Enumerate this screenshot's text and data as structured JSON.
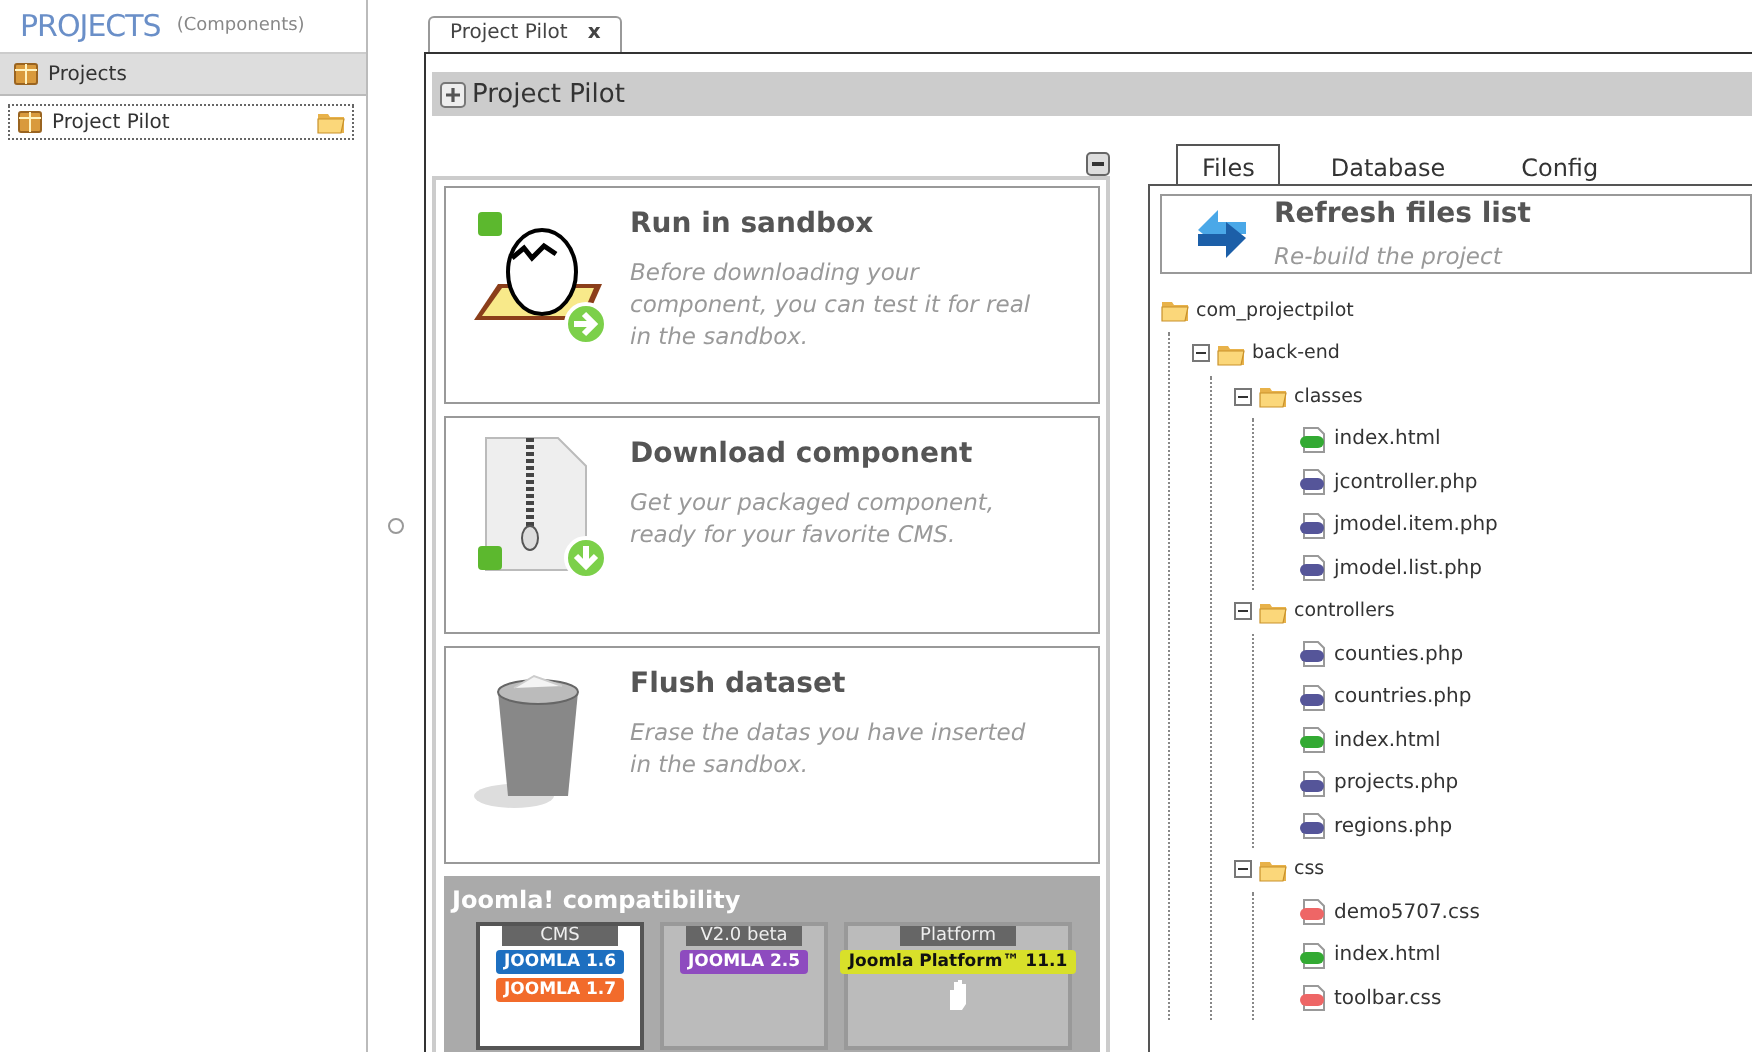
{
  "header": {
    "title": "PROJECTS",
    "subtitle": "(Components)"
  },
  "sidebar": {
    "heading": "Projects",
    "items": [
      {
        "label": "Project Pilot",
        "selected": true
      }
    ]
  },
  "document_tabs": [
    {
      "label": "Project Pilot",
      "close": "x",
      "selected": true
    }
  ],
  "panel": {
    "title": "Project Pilot"
  },
  "actions": [
    {
      "kind": "sandbox",
      "title": "Run in sandbox",
      "description": "Before downloading your component, you can test it for real in the sandbox."
    },
    {
      "kind": "download",
      "title": "Download component",
      "description": "Get your packaged component, ready for your favorite CMS."
    },
    {
      "kind": "flush",
      "title": "Flush dataset",
      "description": "Erase the datas you have inserted in the sandbox."
    }
  ],
  "compatibility": {
    "title": "Joomla! compatibility",
    "groups": [
      {
        "label": "CMS",
        "selected": true,
        "badges": [
          {
            "text": "JOOMLA 1.6",
            "color": "#1d6fc0"
          },
          {
            "text": "JOOMLA 1.7",
            "color": "#f26b2b"
          }
        ]
      },
      {
        "label": "V2.0 beta",
        "selected": false,
        "badges": [
          {
            "text": "JOOMLA 2.5",
            "color": "#8e4bbf"
          }
        ]
      },
      {
        "label": "Platform",
        "selected": false,
        "badges": [
          {
            "text": "Joomla Platform™ 11.1",
            "color": "#d8e02a"
          }
        ]
      }
    ]
  },
  "tabs": [
    {
      "label": "Files",
      "selected": true
    },
    {
      "label": "Database",
      "selected": false
    },
    {
      "label": "Config",
      "selected": false
    }
  ],
  "refresh": {
    "title": "Refresh files list",
    "description": "Re-build the project"
  },
  "tree": [
    {
      "label": "com_projectpilot",
      "kind": "folder",
      "children": [
        {
          "label": "back-end",
          "kind": "folder",
          "expanded": true,
          "children": [
            {
              "label": "classes",
              "kind": "folder",
              "expanded": true,
              "children": [
                {
                  "label": "index.html",
                  "kind": "html"
                },
                {
                  "label": "jcontroller.php",
                  "kind": "php"
                },
                {
                  "label": "jmodel.item.php",
                  "kind": "php"
                },
                {
                  "label": "jmodel.list.php",
                  "kind": "php"
                }
              ]
            },
            {
              "label": "controllers",
              "kind": "folder",
              "expanded": true,
              "children": [
                {
                  "label": "counties.php",
                  "kind": "php"
                },
                {
                  "label": "countries.php",
                  "kind": "php"
                },
                {
                  "label": "index.html",
                  "kind": "html"
                },
                {
                  "label": "projects.php",
                  "kind": "php"
                },
                {
                  "label": "regions.php",
                  "kind": "php"
                }
              ]
            },
            {
              "label": "css",
              "kind": "folder",
              "expanded": true,
              "children": [
                {
                  "label": "demo5707.css",
                  "kind": "css"
                },
                {
                  "label": "index.html",
                  "kind": "html"
                },
                {
                  "label": "toolbar.css",
                  "kind": "css"
                }
              ]
            }
          ]
        }
      ]
    }
  ]
}
